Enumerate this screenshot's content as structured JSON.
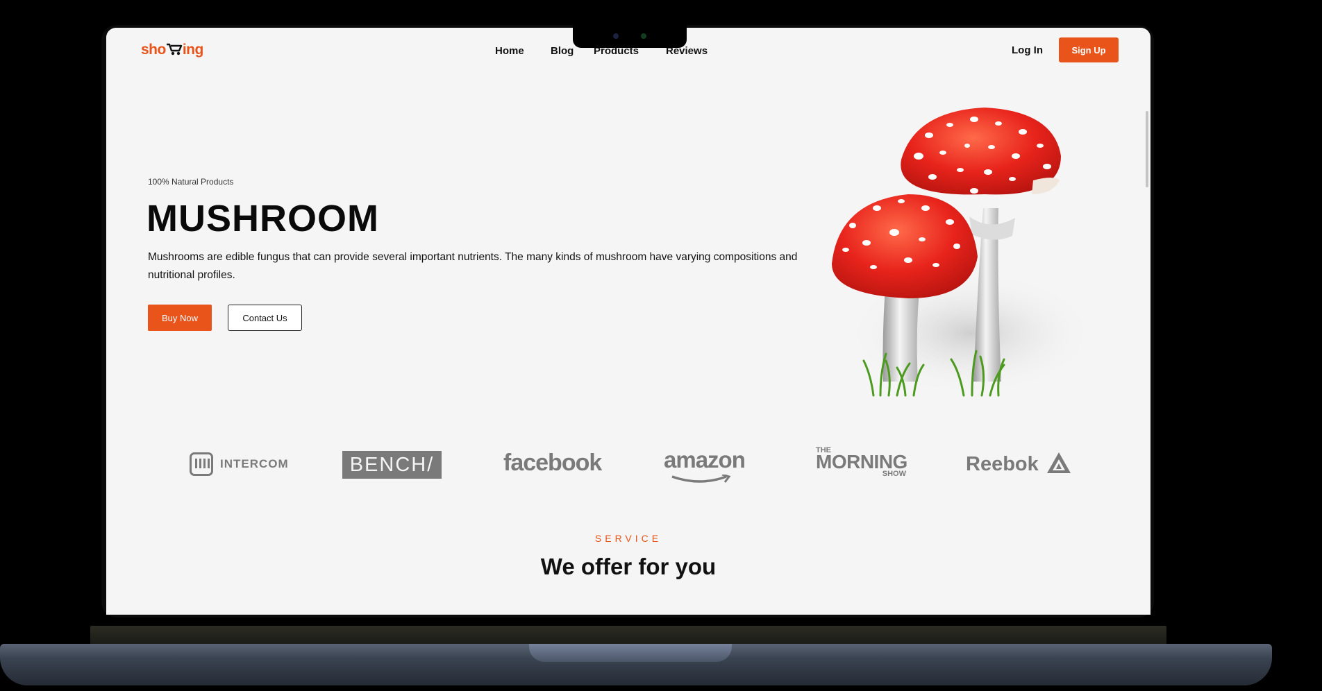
{
  "brand": {
    "logo_text_left": "sho",
    "logo_text_right": "ing",
    "accent_color": "#e8541a"
  },
  "nav": {
    "links": [
      "Home",
      "Blog",
      "Products",
      "Reviews"
    ],
    "login": "Log In",
    "signup": "Sign Up"
  },
  "hero": {
    "tagline": "100% Natural Products",
    "title": "MUSHROOM",
    "description": "Mushrooms are edible fungus that can provide several important nutrients. The many kinds of mushroom have varying compositions and nutritional profiles.",
    "buy_button": "Buy Now",
    "contact_button": "Contact Us"
  },
  "partners": {
    "intercom": "INTERCOM",
    "bench": "BENCH/",
    "facebook": "facebook",
    "amazon": "amazon",
    "morning_the": "THE",
    "morning_main": "MORNING",
    "morning_show": "SHOW",
    "reebok": "Reebok"
  },
  "service": {
    "eyebrow": "SERVICE",
    "title": "We offer for you"
  },
  "icons": [
    "cart-icon",
    "intercom-icon",
    "amazon-smile-icon",
    "reebok-delta-icon",
    "mushroom-illustration"
  ]
}
